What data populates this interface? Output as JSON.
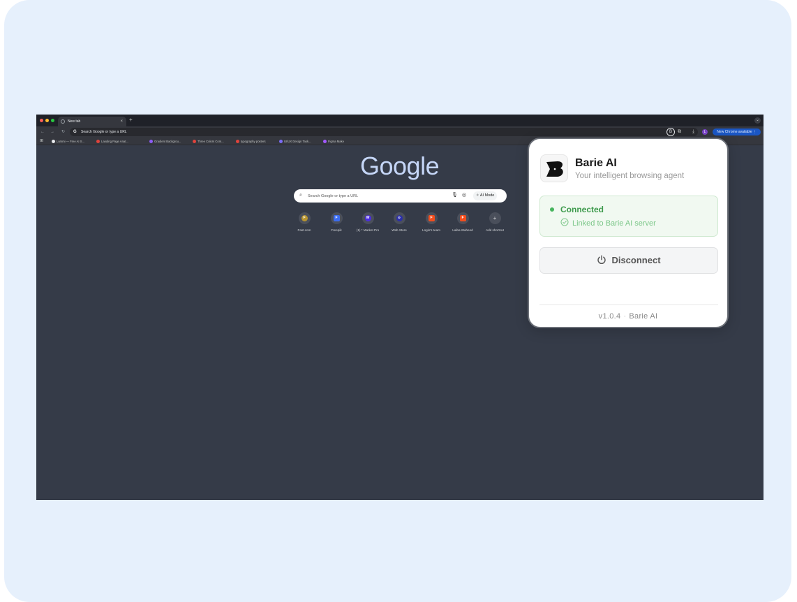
{
  "browser": {
    "tab": {
      "title": "New tab",
      "close": "×"
    },
    "new_tab": "+",
    "omnibox_text": "Search Google or type a URL",
    "omnibox_logo": "G",
    "update_button": "New Chrome available",
    "profile_initial": "L",
    "bookmarks": [
      {
        "label": "Lummi — Free AI S...",
        "icon_color": "#e8eaed"
      },
      {
        "label": "Landing Page Anat...",
        "icon_color": "#e0433c"
      },
      {
        "label": "Gradient Backgrou...",
        "icon_color": "#8c5cf6"
      },
      {
        "label": "Three Colors Com...",
        "icon_color": "#e0433c"
      },
      {
        "label": "typography posters",
        "icon_color": "#e0433c"
      },
      {
        "label": "UI/UX Design Task...",
        "icon_color": "#7b6cf6"
      },
      {
        "label": "Figma Make",
        "icon_color": "#a259ff"
      }
    ]
  },
  "google": {
    "logo": "Google",
    "search_placeholder": "Search Google or type a URL",
    "ai_mode_label": "AI Mode",
    "shortcuts": [
      {
        "label": "Fast.com",
        "glyph": "F",
        "color": "#b8952f"
      },
      {
        "label": "Freepik",
        "glyph": "F",
        "color": "#3b6cf0"
      },
      {
        "label": "(1) * Market Pro",
        "glyph": "W",
        "color": "#4b2de0"
      },
      {
        "label": "Web Store",
        "glyph": "⊙",
        "color": "#2b2fa8"
      },
      {
        "label": "Login's team",
        "glyph": "F",
        "color": "#f24e1e"
      },
      {
        "label": "Laiba Waheed",
        "glyph": "F",
        "color": "#f24e1e"
      },
      {
        "label": "Add shortcut",
        "glyph": "+",
        "color": "#5a5f6b"
      }
    ]
  },
  "popup": {
    "title": "Barie AI",
    "subtitle": "Your intelligent browsing agent",
    "status": "Connected",
    "status_detail": "Linked to Barie AI server",
    "disconnect_label": "Disconnect",
    "version": "v1.0.4",
    "footer_separator": "·",
    "footer_brand": "Barie AI",
    "colors": {
      "status_green": "#3d9a4c",
      "status_bg": "#f1f9f1"
    }
  }
}
